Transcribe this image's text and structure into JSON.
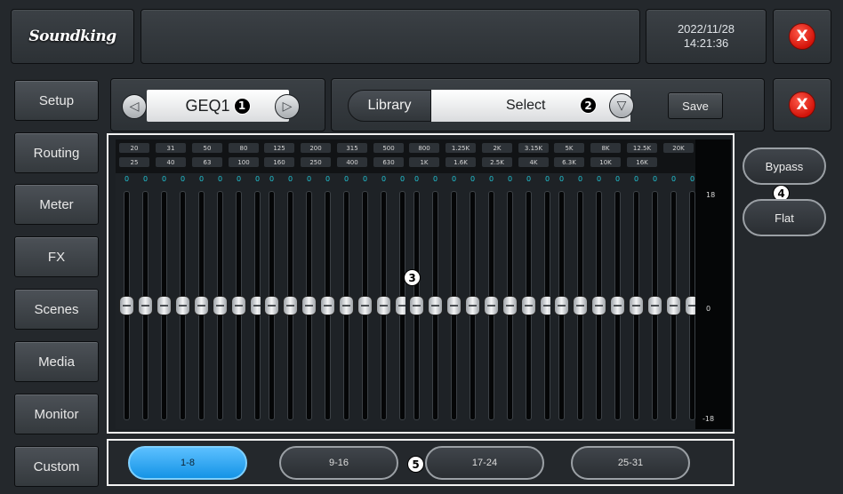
{
  "brand": {
    "logo_text": "Soundking"
  },
  "clock": {
    "date": "2022/11/28",
    "time": "14:21:36"
  },
  "close_label": "X",
  "sidebar": {
    "items": [
      {
        "label": "Setup"
      },
      {
        "label": "Routing"
      },
      {
        "label": "Meter"
      },
      {
        "label": "FX"
      },
      {
        "label": "Scenes"
      },
      {
        "label": "Media"
      },
      {
        "label": "Monitor"
      },
      {
        "label": "Custom"
      }
    ]
  },
  "module": {
    "name": "GEQ1",
    "prev_icon": "triangle-left-icon",
    "next_icon": "triangle-right-icon",
    "prev_glyph": "◁",
    "next_glyph": "▷"
  },
  "library": {
    "label": "Library",
    "value": "Select",
    "dropdown_glyph": "▽",
    "save_label": "Save"
  },
  "callouts": {
    "c1": "1",
    "c2": "2",
    "c3": "3",
    "c4": "4",
    "c5": "5"
  },
  "eq": {
    "groups": [
      {
        "freqs_top": [
          "20",
          "31",
          "50",
          "80"
        ],
        "freqs_bottom": [
          "25",
          "40",
          "63",
          "100"
        ]
      },
      {
        "freqs_top": [
          "125",
          "200",
          "315",
          "500"
        ],
        "freqs_bottom": [
          "160",
          "250",
          "400",
          "630"
        ]
      },
      {
        "freqs_top": [
          "800",
          "1.25K",
          "2K",
          "3.15K"
        ],
        "freqs_bottom": [
          "1K",
          "1.6K",
          "2.5K",
          "4K"
        ]
      },
      {
        "freqs_top": [
          "5K",
          "8K",
          "12.5K",
          "20K"
        ],
        "freqs_bottom": [
          "6.3K",
          "10K",
          "16K"
        ]
      }
    ],
    "gain_values": [
      "0",
      "0",
      "0",
      "0",
      "0",
      "0",
      "0",
      "0",
      "0",
      "0",
      "0",
      "0",
      "0",
      "0",
      "0",
      "0",
      "0",
      "0",
      "0",
      "0",
      "0",
      "0",
      "0",
      "0",
      "0",
      "0",
      "0",
      "0",
      "0",
      "0",
      "0",
      "0"
    ],
    "scale": {
      "top": "18",
      "mid": "0",
      "bottom": "-18"
    }
  },
  "right_buttons": {
    "bypass": "Bypass",
    "flat": "Flat"
  },
  "pages": [
    {
      "label": "1-8",
      "active": true
    },
    {
      "label": "9-16",
      "active": false
    },
    {
      "label": "17-24",
      "active": false
    },
    {
      "label": "25-31",
      "active": false
    }
  ],
  "colors": {
    "active_page": "#1493e6",
    "gain_text": "#21c4d3",
    "close": "#d3140a"
  }
}
